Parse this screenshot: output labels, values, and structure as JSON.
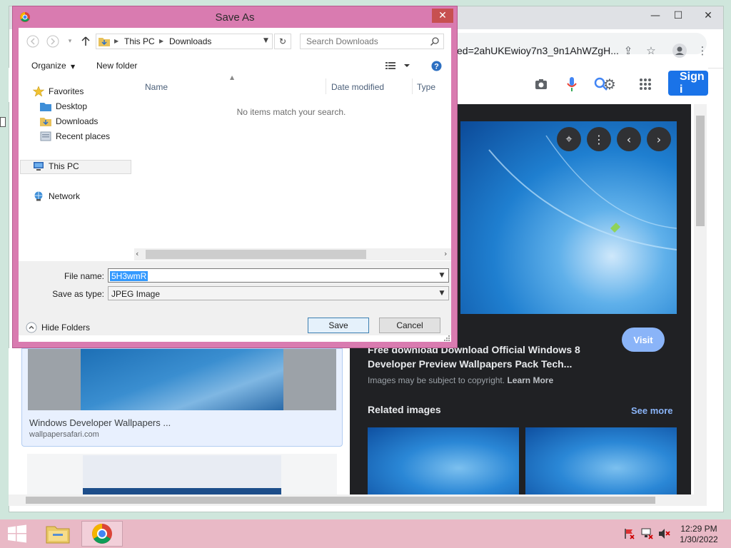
{
  "browser": {
    "url_fragment": "ed=2ahUKEwioy7n3_9n1AhWZgH...",
    "signin_label": "Sign i"
  },
  "google": {
    "left_card": {
      "title": "Windows Developer Wallpapers ...",
      "site": "wallpapersafari.com"
    },
    "visit_label": "Visit",
    "result_title": "Free download Download Official Windows 8 Developer Preview Wallpapers Pack Tech...",
    "copyright_text": "Images may be subject to copyright.",
    "learn_more": "Learn More",
    "related_label": "Related images",
    "see_more": "See more"
  },
  "dialog": {
    "title": "Save As",
    "breadcrumb": [
      "This PC",
      "Downloads"
    ],
    "search_placeholder": "Search Downloads",
    "organize_label": "Organize",
    "new_folder_label": "New folder",
    "nav": {
      "favorites": "Favorites",
      "desktop": "Desktop",
      "downloads": "Downloads",
      "recent": "Recent places",
      "this_pc": "This PC",
      "network": "Network"
    },
    "columns": [
      "Name",
      "Date modified",
      "Type"
    ],
    "empty_message": "No items match your search.",
    "file_name_label": "File name:",
    "file_name_value": "5H3wmR",
    "save_type_label": "Save as type:",
    "save_type_value": "JPEG Image",
    "hide_folders_label": "Hide Folders",
    "save_label": "Save",
    "cancel_label": "Cancel"
  },
  "taskbar": {
    "time": "12:29 PM",
    "date": "1/30/2022"
  },
  "colors": {
    "dialog_frame": "#d97bb0",
    "taskbar": "#e9b9c6",
    "google_blue": "#1a73e8",
    "selection": "#3399ff"
  },
  "icons": [
    "chrome-icon",
    "minimize-icon",
    "maximize-icon",
    "close-icon",
    "share-icon",
    "star-icon",
    "profile-icon",
    "kebab-menu-icon",
    "camera-icon",
    "mic-icon",
    "lens-icon",
    "settings-gear-icon",
    "apps-grid-icon",
    "back-arrow-icon",
    "forward-arrow-icon",
    "up-arrow-icon",
    "folder-icon",
    "refresh-icon",
    "search-icon",
    "view-icon",
    "help-icon",
    "windows-start-icon",
    "file-explorer-icon"
  ]
}
